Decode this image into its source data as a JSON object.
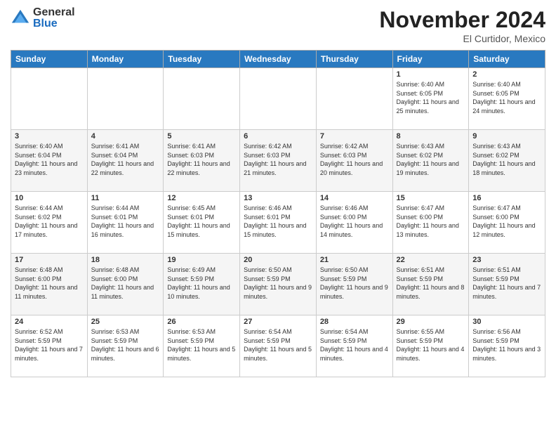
{
  "logo": {
    "general": "General",
    "blue": "Blue"
  },
  "title": "November 2024",
  "location": "El Curtidor, Mexico",
  "days": [
    "Sunday",
    "Monday",
    "Tuesday",
    "Wednesday",
    "Thursday",
    "Friday",
    "Saturday"
  ],
  "weeks": [
    [
      {
        "day": "",
        "content": ""
      },
      {
        "day": "",
        "content": ""
      },
      {
        "day": "",
        "content": ""
      },
      {
        "day": "",
        "content": ""
      },
      {
        "day": "",
        "content": ""
      },
      {
        "day": "1",
        "content": "Sunrise: 6:40 AM\nSunset: 6:05 PM\nDaylight: 11 hours and 25 minutes."
      },
      {
        "day": "2",
        "content": "Sunrise: 6:40 AM\nSunset: 6:05 PM\nDaylight: 11 hours and 24 minutes."
      }
    ],
    [
      {
        "day": "3",
        "content": "Sunrise: 6:40 AM\nSunset: 6:04 PM\nDaylight: 11 hours and 23 minutes."
      },
      {
        "day": "4",
        "content": "Sunrise: 6:41 AM\nSunset: 6:04 PM\nDaylight: 11 hours and 22 minutes."
      },
      {
        "day": "5",
        "content": "Sunrise: 6:41 AM\nSunset: 6:03 PM\nDaylight: 11 hours and 22 minutes."
      },
      {
        "day": "6",
        "content": "Sunrise: 6:42 AM\nSunset: 6:03 PM\nDaylight: 11 hours and 21 minutes."
      },
      {
        "day": "7",
        "content": "Sunrise: 6:42 AM\nSunset: 6:03 PM\nDaylight: 11 hours and 20 minutes."
      },
      {
        "day": "8",
        "content": "Sunrise: 6:43 AM\nSunset: 6:02 PM\nDaylight: 11 hours and 19 minutes."
      },
      {
        "day": "9",
        "content": "Sunrise: 6:43 AM\nSunset: 6:02 PM\nDaylight: 11 hours and 18 minutes."
      }
    ],
    [
      {
        "day": "10",
        "content": "Sunrise: 6:44 AM\nSunset: 6:02 PM\nDaylight: 11 hours and 17 minutes."
      },
      {
        "day": "11",
        "content": "Sunrise: 6:44 AM\nSunset: 6:01 PM\nDaylight: 11 hours and 16 minutes."
      },
      {
        "day": "12",
        "content": "Sunrise: 6:45 AM\nSunset: 6:01 PM\nDaylight: 11 hours and 15 minutes."
      },
      {
        "day": "13",
        "content": "Sunrise: 6:46 AM\nSunset: 6:01 PM\nDaylight: 11 hours and 15 minutes."
      },
      {
        "day": "14",
        "content": "Sunrise: 6:46 AM\nSunset: 6:00 PM\nDaylight: 11 hours and 14 minutes."
      },
      {
        "day": "15",
        "content": "Sunrise: 6:47 AM\nSunset: 6:00 PM\nDaylight: 11 hours and 13 minutes."
      },
      {
        "day": "16",
        "content": "Sunrise: 6:47 AM\nSunset: 6:00 PM\nDaylight: 11 hours and 12 minutes."
      }
    ],
    [
      {
        "day": "17",
        "content": "Sunrise: 6:48 AM\nSunset: 6:00 PM\nDaylight: 11 hours and 11 minutes."
      },
      {
        "day": "18",
        "content": "Sunrise: 6:48 AM\nSunset: 6:00 PM\nDaylight: 11 hours and 11 minutes."
      },
      {
        "day": "19",
        "content": "Sunrise: 6:49 AM\nSunset: 5:59 PM\nDaylight: 11 hours and 10 minutes."
      },
      {
        "day": "20",
        "content": "Sunrise: 6:50 AM\nSunset: 5:59 PM\nDaylight: 11 hours and 9 minutes."
      },
      {
        "day": "21",
        "content": "Sunrise: 6:50 AM\nSunset: 5:59 PM\nDaylight: 11 hours and 9 minutes."
      },
      {
        "day": "22",
        "content": "Sunrise: 6:51 AM\nSunset: 5:59 PM\nDaylight: 11 hours and 8 minutes."
      },
      {
        "day": "23",
        "content": "Sunrise: 6:51 AM\nSunset: 5:59 PM\nDaylight: 11 hours and 7 minutes."
      }
    ],
    [
      {
        "day": "24",
        "content": "Sunrise: 6:52 AM\nSunset: 5:59 PM\nDaylight: 11 hours and 7 minutes."
      },
      {
        "day": "25",
        "content": "Sunrise: 6:53 AM\nSunset: 5:59 PM\nDaylight: 11 hours and 6 minutes."
      },
      {
        "day": "26",
        "content": "Sunrise: 6:53 AM\nSunset: 5:59 PM\nDaylight: 11 hours and 5 minutes."
      },
      {
        "day": "27",
        "content": "Sunrise: 6:54 AM\nSunset: 5:59 PM\nDaylight: 11 hours and 5 minutes."
      },
      {
        "day": "28",
        "content": "Sunrise: 6:54 AM\nSunset: 5:59 PM\nDaylight: 11 hours and 4 minutes."
      },
      {
        "day": "29",
        "content": "Sunrise: 6:55 AM\nSunset: 5:59 PM\nDaylight: 11 hours and 4 minutes."
      },
      {
        "day": "30",
        "content": "Sunrise: 6:56 AM\nSunset: 5:59 PM\nDaylight: 11 hours and 3 minutes."
      }
    ]
  ]
}
